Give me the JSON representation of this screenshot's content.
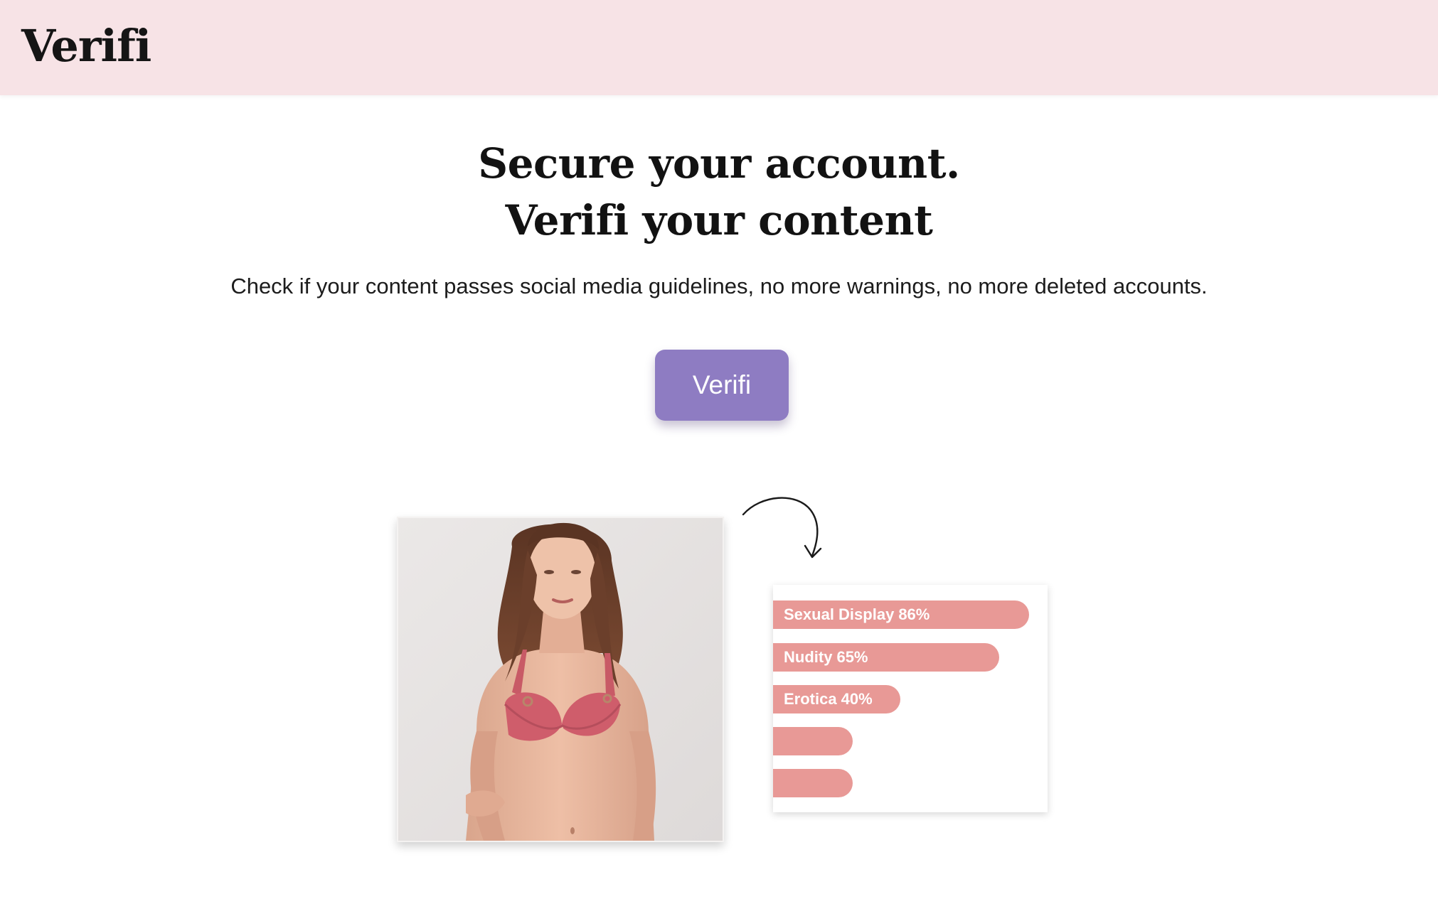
{
  "header": {
    "brand": "Verifi",
    "background_color": "#f7e3e6"
  },
  "hero": {
    "title_line_1": "Secure your account.",
    "title_line_2": "Verifi your content",
    "subtitle": "Check if your content passes social media guidelines, no more warnings, no more deleted accounts.",
    "button_label": "Verifi",
    "button_color": "#8e7cc2"
  },
  "illustration": {
    "photo_icon": "woman-in-pink-bikini-photo",
    "arrow_icon": "curved-arrow-icon",
    "bar_color": "#e89996",
    "results": [
      {
        "label": "Sexual Display",
        "percent": "86%",
        "value": 0.86
      },
      {
        "label": "Nudity",
        "percent": "65%",
        "value": 0.65
      },
      {
        "label": "Erotica",
        "percent": "40%",
        "value": 0.4
      },
      {
        "label": "",
        "percent": "",
        "value": null
      },
      {
        "label": "",
        "percent": "",
        "value": null
      }
    ]
  }
}
